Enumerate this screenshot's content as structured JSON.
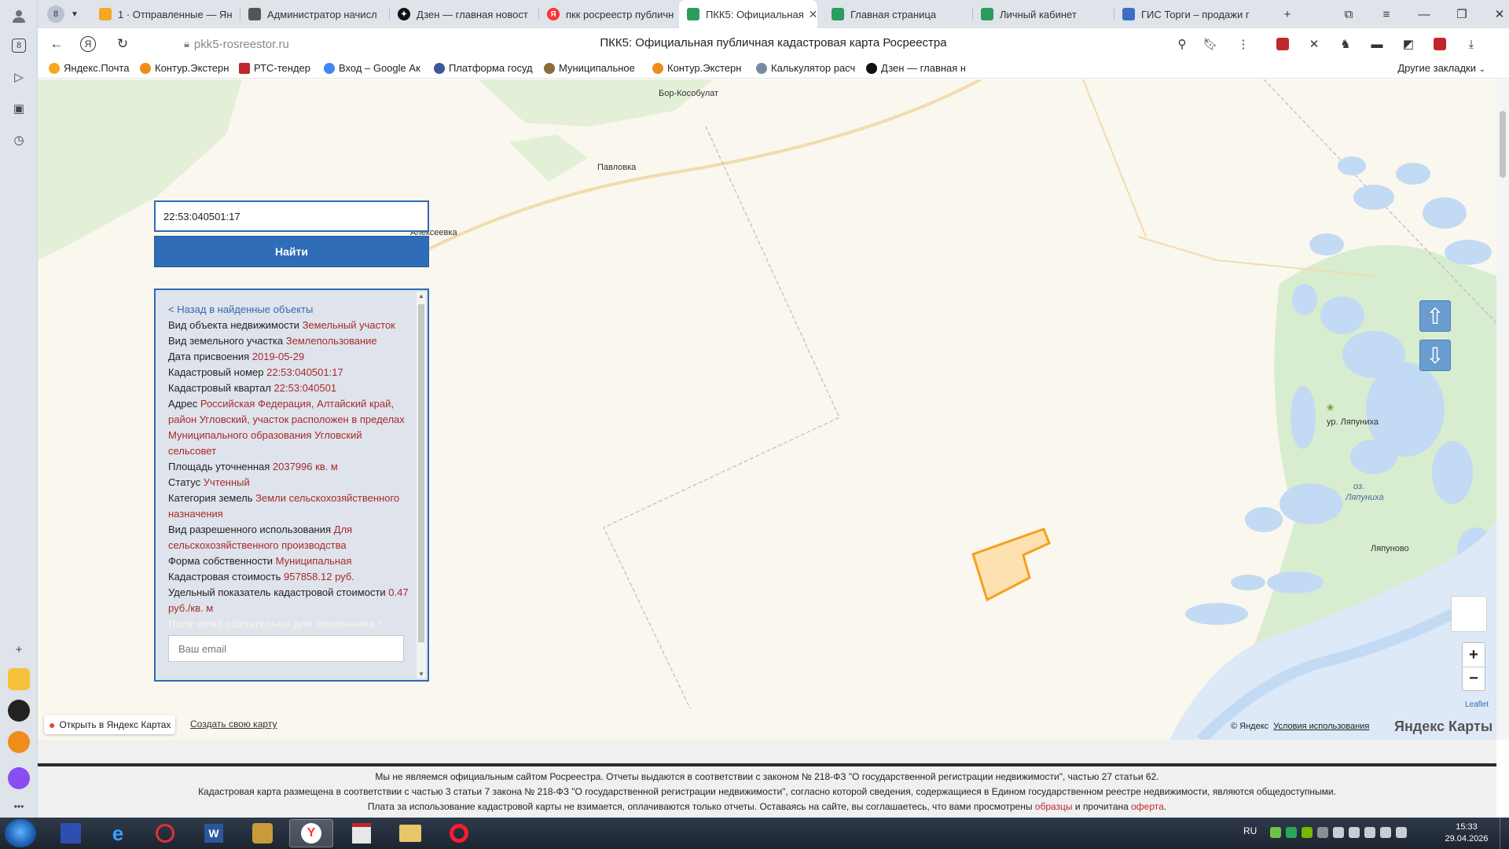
{
  "tabs": [
    {
      "label": "1 · Отправленные — Ян",
      "color": "#f5a623",
      "active": false
    },
    {
      "label": "Администратор начисл",
      "color": "#555555",
      "active": false
    },
    {
      "label": "Дзен — главная новост",
      "color": "#111111",
      "active": false
    },
    {
      "label": "пкк росреестр публичн",
      "color": "#f33",
      "active": false
    },
    {
      "label": "ПКК5: Официальная",
      "color": "#2a9d5c",
      "active": true
    },
    {
      "label": "Главная страница",
      "color": "#2a9d5c",
      "active": false
    },
    {
      "label": "Личный кабинет",
      "color": "#2a9d5c",
      "active": false
    },
    {
      "label": "ГИС Торги – продажи г",
      "color": "#3b6fc2",
      "active": false
    }
  ],
  "tab_count": "8",
  "address": {
    "host": "pkk5-rosreestor.ru",
    "title": "ПКК5: Официальная публичная кадастровая карта Росреестра"
  },
  "bookmarks": [
    {
      "label": "Яндекс.Почта",
      "color": "#f5a623"
    },
    {
      "label": "Контур.Экстерн",
      "color": "#f08c1a"
    },
    {
      "label": "РТС-тендер",
      "color": "#c0262c"
    },
    {
      "label": "Вход – Google Ак",
      "color": "#4285f4"
    },
    {
      "label": "Платформа госуд",
      "color": "#3b5998"
    },
    {
      "label": "Муниципальное",
      "color": "#8a6d3b"
    },
    {
      "label": "Контур.Экстерн",
      "color": "#f08c1a"
    },
    {
      "label": "Калькулятор расч",
      "color": "#7a8aa0"
    },
    {
      "label": "Дзен — главная н",
      "color": "#111111"
    }
  ],
  "bookmarks_other": "Другие закладки",
  "search": {
    "value": "22:53:040501:17",
    "button": "Найти"
  },
  "info": {
    "back": "< Назад в найденные объекты",
    "fields": [
      {
        "label": "Вид объекта недвижимости",
        "value": "Земельный участок"
      },
      {
        "label": "Вид земельного участка",
        "value": "Землепользование"
      },
      {
        "label": "Дата присвоения",
        "value": "2019-05-29"
      },
      {
        "label": "Кадастровый номер",
        "value": "22:53:040501:17"
      },
      {
        "label": "Кадастровый квартал",
        "value": "22:53:040501"
      },
      {
        "label": "Адрес",
        "value": "Российская Федерация, Алтайский край, район Угловский, участок расположен в пределах Муниципального образования Угловский сельсовет"
      },
      {
        "label": "Площадь уточненная",
        "value": "2037996 кв. м"
      },
      {
        "label": "Статус",
        "value": "Учтенный"
      },
      {
        "label": "Категория земель",
        "value": "Земли сельскохозяйственного назначения"
      },
      {
        "label": "Вид разрешенного использования",
        "value": "Для сельскохозяйственного производства"
      },
      {
        "label": "Форма собственности",
        "value": "Муниципальная"
      },
      {
        "label": "Кадастровая стоимость",
        "value": "957858.12 руб."
      },
      {
        "label": "Удельный показатель кадастровой стоимости",
        "value": "0.47 руб./кв. м"
      }
    ],
    "email_required": "Поле email обязательно для заполнения *",
    "email_placeholder": "Ваш email"
  },
  "map": {
    "places": {
      "bor": "Бор-Кособулат",
      "pavlovka": "Павловка",
      "alekseevka": "Алексеевка",
      "lyapunikha_ur": "ур. Ляпуниха",
      "lake1": "оз.",
      "lake2": "Ляпуниха",
      "lyapunovo": "Ляпуново"
    },
    "open_yandex": "Открыть в Яндекс Картах",
    "create_map": "Создать свою карту",
    "copyright": "© Яндекс",
    "terms": "Условия использования",
    "brand": "Яндекс Карты",
    "leaflet": "Leaflet",
    "parcel_color": "#f5a020"
  },
  "footer": {
    "line1": "Мы не являемся официальным сайтом Росреестра. Отчеты выдаются в соответствии с законом № 218-ФЗ \"О государственной регистрации недвижимости\", частью 27 статьи 62.",
    "line2": "Кадастровая карта размещена в соответствии с частью 3 статьи 7 закона № 218-ФЗ \"О государственной регистрации недвижимости\", согласно которой сведения, содержащиеся в Едином государственном реестре недвижимости, являются общедоступными.",
    "line3_a": "Плата за использование кадастровой карты не взимается, оплачиваются только отчеты. Оставаясь на сайте, вы соглашаетесь, что вами просмотрены ",
    "line3_link1": "образцы",
    "line3_b": " и прочитана ",
    "line3_link2": "оферта",
    "line3_c": "."
  },
  "taskbar": {
    "lang": "RU",
    "time": "15:33",
    "date": "29.04.2026"
  }
}
